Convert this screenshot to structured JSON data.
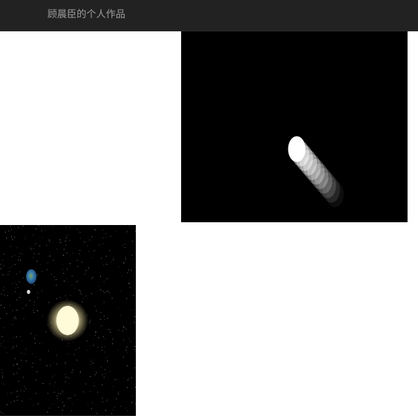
{
  "navbar": {
    "brand": "顾晨臣的个人作品"
  },
  "works": [
    {
      "id": "bouncing-ball",
      "type": "canvas-animation",
      "background": "#000000",
      "ball_color": "#ffffff"
    },
    {
      "id": "solar-system",
      "type": "canvas-animation",
      "background": "#000000",
      "sun_color": "#fff8d8",
      "sun_glow_color": "#fff2b0",
      "earth_color": "#2f6fa8",
      "earth_land_color": "#9a8f4a",
      "moon_color": "#cfcfcf"
    }
  ]
}
